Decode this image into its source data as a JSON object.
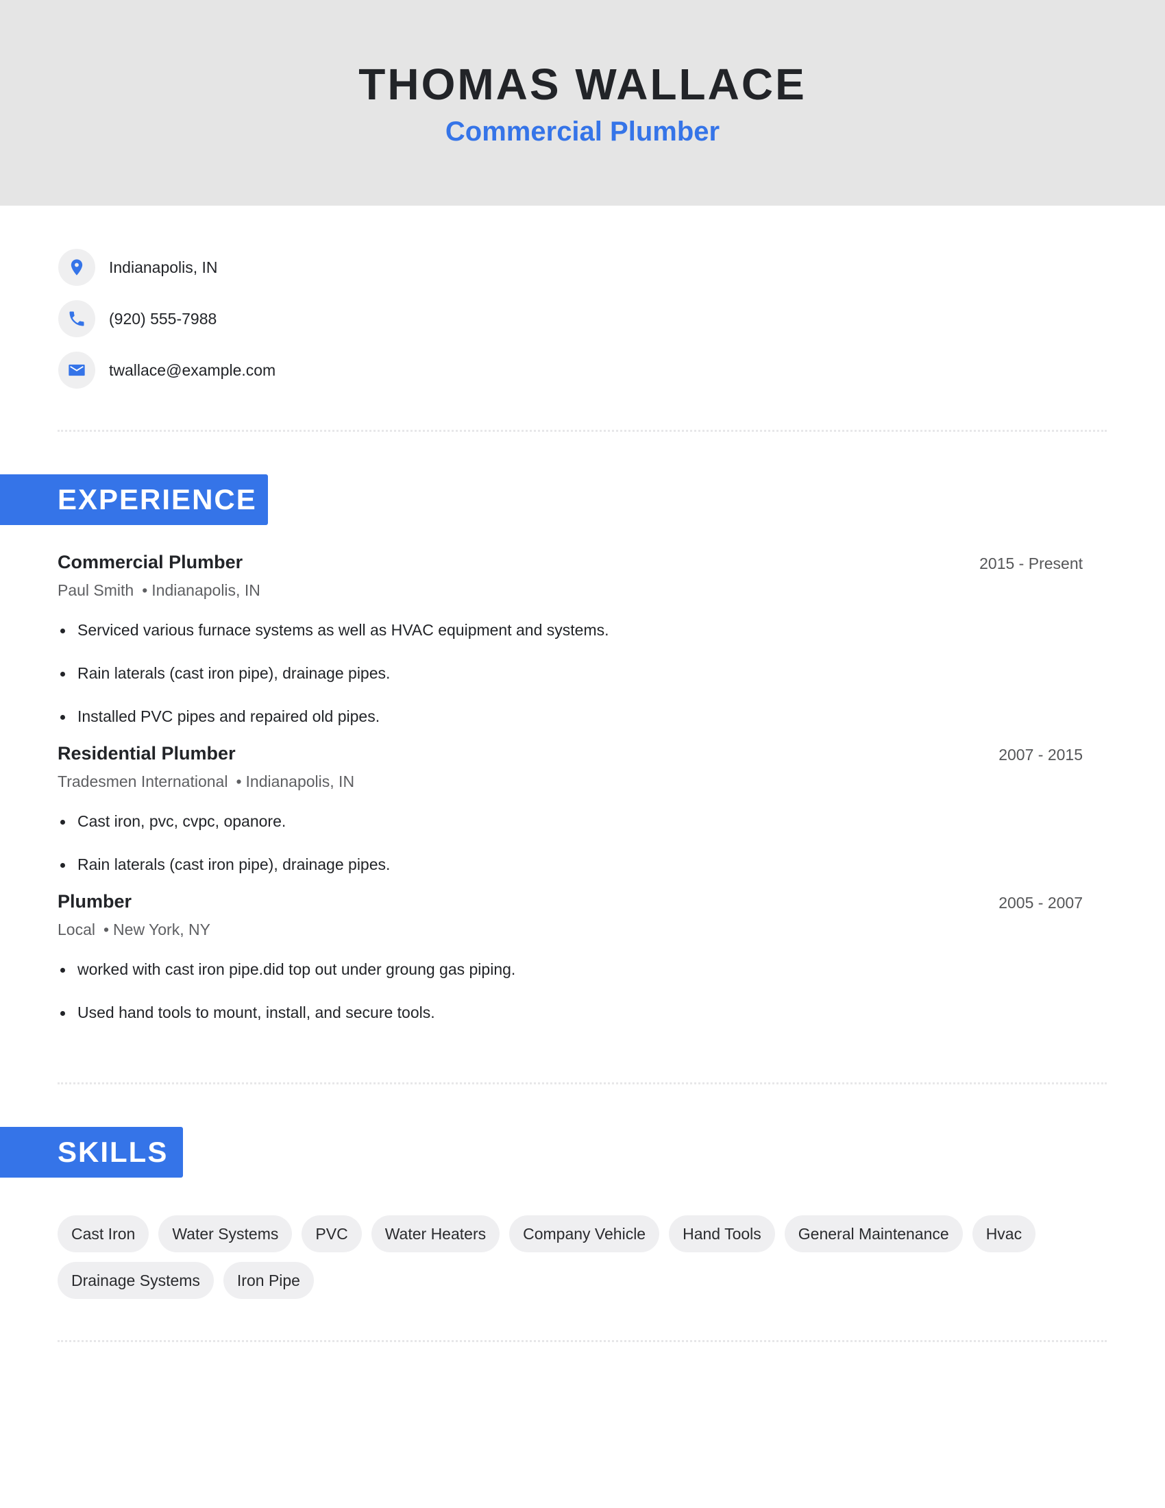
{
  "header": {
    "name": "THOMAS WALLACE",
    "title": "Commercial Plumber"
  },
  "contact": {
    "location": {
      "icon": "location-pin-icon",
      "text": "Indianapolis, IN"
    },
    "phone": {
      "icon": "phone-icon",
      "text": "(920) 555-7988"
    },
    "email": {
      "icon": "email-icon",
      "text": "twallace@example.com"
    }
  },
  "colors": {
    "accent": "#3574e8",
    "header_bg": "#e5e5e5",
    "chip_bg": "#efeff1",
    "text": "#222428"
  },
  "experience": {
    "heading": "EXPERIENCE",
    "jobs": [
      {
        "title": "Commercial Plumber",
        "company": "Paul Smith",
        "separator": "•",
        "location": "Indianapolis, IN",
        "dates": "2015 - Present",
        "bullets": [
          "Serviced various furnace systems as well as HVAC equipment and systems.",
          "Rain laterals (cast iron pipe), drainage pipes.",
          "Installed PVC pipes and repaired old pipes."
        ]
      },
      {
        "title": "Residential Plumber",
        "company": "Tradesmen International",
        "separator": "•",
        "location": "Indianapolis, IN",
        "dates": "2007 - 2015",
        "bullets": [
          "Cast iron, pvc, cvpc, opanore.",
          "Rain laterals (cast iron pipe), drainage pipes."
        ]
      },
      {
        "title": "Plumber",
        "company": "Local",
        "separator": "•",
        "location": "New York, NY",
        "dates": "2005 - 2007",
        "bullets": [
          "worked with cast iron pipe.did top out under groung gas piping.",
          "Used hand tools to mount, install, and secure tools."
        ]
      }
    ]
  },
  "skills": {
    "heading": "SKILLS",
    "items": [
      "Cast Iron",
      "Water Systems",
      "PVC",
      "Water Heaters",
      "Company Vehicle",
      "Hand Tools",
      "General Maintenance",
      "Hvac",
      "Drainage Systems",
      "Iron Pipe"
    ]
  }
}
